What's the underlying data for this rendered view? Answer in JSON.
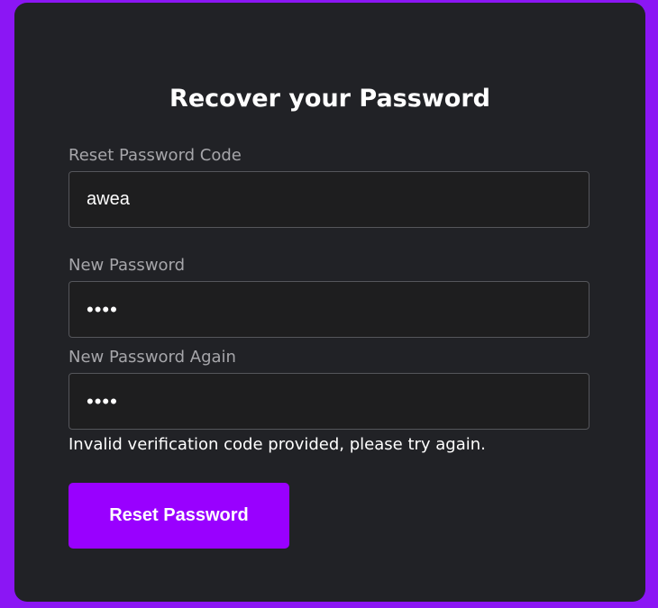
{
  "form": {
    "title": "Recover your Password",
    "reset_code": {
      "label": "Reset Password Code",
      "value": "awea"
    },
    "new_password": {
      "label": "New Password",
      "value": "••••"
    },
    "new_password_again": {
      "label": "New Password Again",
      "value": "••••"
    },
    "error_message": "Invalid verification code provided, please try again.",
    "submit_label": "Reset Password"
  },
  "colors": {
    "page_background": "#8b16f4",
    "card_background": "#212226",
    "field_background": "#1e1e1f",
    "field_border": "#55565b",
    "label_text": "#a6a6aa",
    "button_background": "#9900ff"
  }
}
